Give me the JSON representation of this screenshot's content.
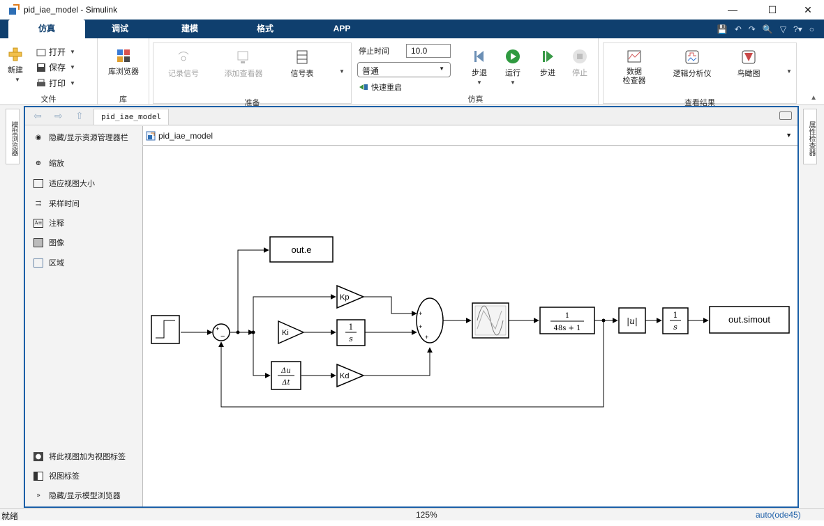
{
  "window": {
    "title": "pid_iae_model - Simulink"
  },
  "tabs": [
    "仿真",
    "调试",
    "建模",
    "格式",
    "APP"
  ],
  "ribbon": {
    "file": {
      "new_label": "新建",
      "open_label": "打开",
      "save_label": "保存",
      "print_label": "打印",
      "group_label": "文件"
    },
    "library": {
      "browser_label": "库浏览器",
      "group_label": "库"
    },
    "prepare": {
      "record_label": "记录信号",
      "viewer_label": "添加查看器",
      "signal_table_label": "信号表",
      "group_label": "准备"
    },
    "simulate": {
      "stop_time_label": "停止时间",
      "stop_time_value": "10.0",
      "mode_value": "普通",
      "fast_restart_label": "快速重启",
      "step_back_label": "步退",
      "run_label": "运行",
      "step_forward_label": "步进",
      "stop_label": "停止",
      "group_label": "仿真"
    },
    "results": {
      "data_inspector_line1": "数据",
      "data_inspector_line2": "检查器",
      "logic_analyzer_label": "逻辑分析仪",
      "birds_eye_label": "鸟瞰图",
      "group_label": "查看结果"
    }
  },
  "side": {
    "left_strip": "模型浏览器",
    "right_strip": "属性检查器"
  },
  "editor": {
    "breadcrumb_tab": "pid_iae_model",
    "path": "pid_iae_model",
    "left_panel": {
      "toggle_explorer": "隐藏/显示资源管理器栏",
      "items": [
        "缩放",
        "适应视图大小",
        "采样时间",
        "注释",
        "图像",
        "区域"
      ],
      "bottom_items": [
        "将此视图加为视图标签",
        "视图标签",
        "隐藏/显示模型浏览器"
      ]
    }
  },
  "diagram": {
    "out_e_label": "out.e",
    "out_simout_label": "out.simout",
    "kp_label": "Kp",
    "ki_label": "Ki",
    "kd_label": "Kd",
    "integrator_num": "1",
    "integrator_den": "s",
    "deriv_num": "Δu",
    "deriv_den": "Δt",
    "tf_num": "1",
    "tf_den": "48s + 1",
    "abs_label": "|u|",
    "int2_num": "1",
    "int2_den": "s",
    "sum1_signs": [
      "+",
      "−"
    ],
    "sum2_signs": [
      "+",
      "+",
      "+"
    ]
  },
  "status": {
    "left": "就绪",
    "center": "125%",
    "right": "auto(ode45)"
  }
}
